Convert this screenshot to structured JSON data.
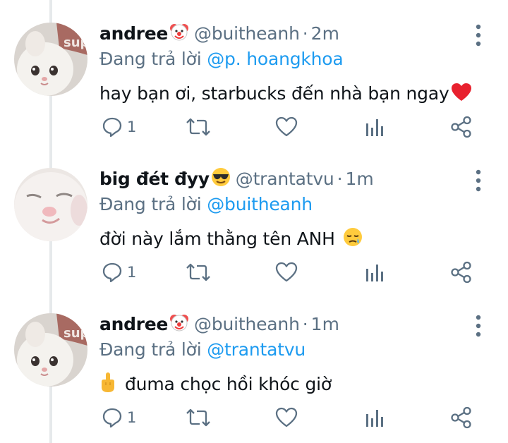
{
  "colors": {
    "text_primary": "#0f1419",
    "text_secondary": "#5b7083",
    "link": "#1d9bf0",
    "thread_line": "#e6e9eb",
    "heart": "#e0245e"
  },
  "thread": {
    "tweets": [
      {
        "display_name": "andree",
        "name_emoji": "clown-face",
        "handle": "@buitheanh",
        "separator": "·",
        "time": "2m",
        "reply_prefix": "Đang trả lời",
        "reply_mention": "@p. hoangkhoa",
        "text": "hay bạn ơi, starbucks đến nhà bạn ngay",
        "text_emoji": "red-heart",
        "reply_count": "1"
      },
      {
        "display_name": "big đét đyy",
        "name_emoji": "smiling-face-with-sunglasses",
        "handle": "@trantatvu",
        "separator": "·",
        "time": "1m",
        "reply_prefix": "Đang trả lời",
        "reply_mention": "@buitheanh",
        "text": "đời này lắm thằng tên ANH",
        "text_emoji": "sleepy-face",
        "reply_count": "1"
      },
      {
        "display_name": "andree",
        "name_emoji": "clown-face",
        "handle": "@buitheanh",
        "separator": "·",
        "time": "1m",
        "reply_prefix": "Đang trả lời",
        "reply_mention": "@trantatvu",
        "text_emoji_leading": "middle-finger",
        "text": "đuma chọc hồi khóc giờ",
        "reply_count": "1"
      }
    ]
  }
}
